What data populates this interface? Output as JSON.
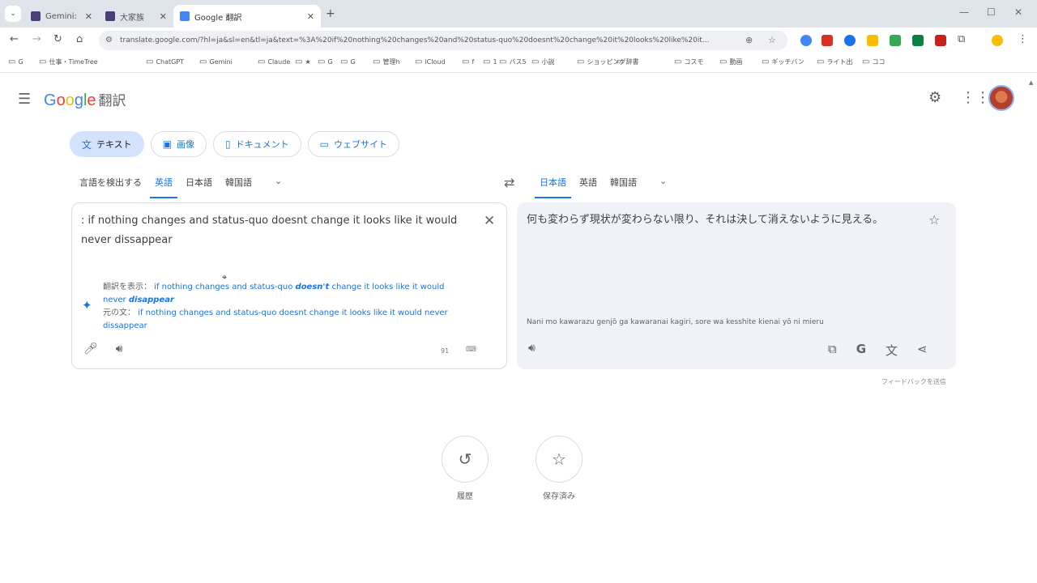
{
  "browser": {
    "tabs": [
      {
        "label": "Gemini: ",
        "active": false
      },
      {
        "label": "大家族 ",
        "active": false
      },
      {
        "label": "Google 翻訳",
        "active": true
      }
    ],
    "url": "translate.google.com/?hl=ja&sl=en&tl=ja&text=%3A%20if%20nothing%20changes%20and%20status-quo%20doesnt%20change%20it%20looks%20like%20it...",
    "bookmarks": [
      "G",
      "仕事・TimeTree",
      "ChatGPT",
      "Gemini",
      "Claude",
      "★",
      "G",
      "G",
      "管理h",
      "iCloud",
      "f",
      "1",
      "バス5",
      "小説",
      "ショッピング",
      "辞書",
      "コスモ",
      "動画",
      "ギッチバン",
      "ライト出",
      "ココ"
    ]
  },
  "header": {
    "logo_google": "Google",
    "logo_suffix": "翻訳"
  },
  "modes": [
    {
      "label": "テキスト",
      "icon": "translate-icon",
      "active": true
    },
    {
      "label": "画像",
      "icon": "image-icon",
      "active": false
    },
    {
      "label": "ドキュメント",
      "icon": "document-icon",
      "active": false
    },
    {
      "label": "ウェブサイト",
      "icon": "website-icon",
      "active": false
    }
  ],
  "source_langs": [
    {
      "label": "言語を検出する",
      "active": false
    },
    {
      "label": "英語",
      "active": true
    },
    {
      "label": "日本語",
      "active": false
    },
    {
      "label": "韓国語",
      "active": false
    }
  ],
  "target_langs": [
    {
      "label": "日本語",
      "active": true
    },
    {
      "label": "英語",
      "active": false
    },
    {
      "label": "韓国語",
      "active": false
    }
  ],
  "source": {
    "text": ": if nothing changes and status-quo doesnt change it looks like it would never dissappear",
    "suggest_prefix": "翻訳を表示：",
    "suggest_text_a": "if nothing changes and status-quo ",
    "suggest_bold_1": "doesn't",
    "suggest_text_b": " change it looks like it would never ",
    "suggest_bold_2": "disappear",
    "original_prefix": "元の文：",
    "original_text": "if nothing changes and status-quo doesnt change it looks like it would never dissappear",
    "char_count": "91",
    "keyboard_label": "⌨"
  },
  "target": {
    "text": "何も変わらず現状が変わらない限り、それは決して消えないように見える。",
    "romaji": "Nani mo kawarazu genjō ga kawaranai kagiri, sore wa kesshite kienai yō ni mieru"
  },
  "feedback": "フィードバックを送信",
  "bottom": {
    "history_label": "履歴",
    "saved_label": "保存済み"
  }
}
